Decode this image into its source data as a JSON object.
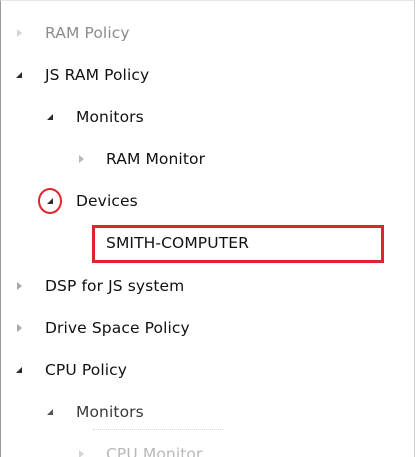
{
  "tree": {
    "items": [
      {
        "label": "RAM Policy",
        "expanded": false,
        "level": 0,
        "state": "faded"
      },
      {
        "label": "JS RAM Policy",
        "expanded": true,
        "level": 0
      },
      {
        "label": "Monitors",
        "expanded": true,
        "level": 1
      },
      {
        "label": "RAM  Monitor",
        "expanded": false,
        "level": 2
      },
      {
        "label": "Devices",
        "expanded": true,
        "level": 1,
        "annotation": "red-circle"
      },
      {
        "label": "SMITH-COMPUTER",
        "level": 2,
        "annotation": "red-box"
      },
      {
        "label": "DSP for JS system",
        "expanded": false,
        "level": 0
      },
      {
        "label": "Drive Space Policy",
        "expanded": false,
        "level": 0
      },
      {
        "label": "CPU Policy",
        "expanded": true,
        "level": 0
      },
      {
        "label": "Monitors",
        "expanded": true,
        "level": 1
      },
      {
        "label": "CPU Monitor",
        "expanded": false,
        "level": 2,
        "state": "faded"
      }
    ]
  },
  "colors": {
    "annotation": "#e0242c",
    "text": "#111111",
    "faded_text": "#8c8c8c"
  }
}
